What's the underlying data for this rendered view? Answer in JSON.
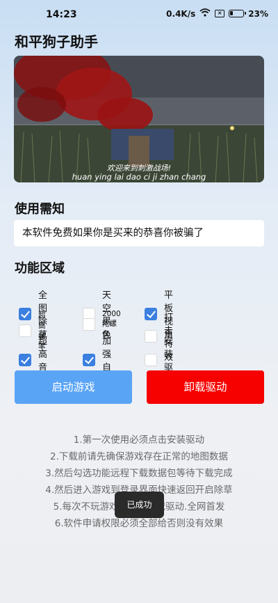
{
  "status_bar": {
    "time": "14:23",
    "network_speed": "0.4K/s",
    "battery": "23%"
  },
  "app": {
    "title": "和平狗子助手"
  },
  "banner": {
    "caption_cn": "欢迎来到刺激战场!",
    "caption_pinyin": "huan ying lai dao ci ji zhan chang"
  },
  "notice": {
    "title": "使用需知",
    "text": "本软件免费如果你是买来的恭喜你被骗了"
  },
  "features": {
    "title": "功能区域",
    "items": [
      {
        "label": "全图除草",
        "checked": true
      },
      {
        "label": "天空黑色",
        "checked": false
      },
      {
        "label": "平板视角",
        "checked": true
      },
      {
        "label": "超高帧率",
        "checked": false
      },
      {
        "label": "2000陀螺仪",
        "checked": false
      },
      {
        "label": "打击特效",
        "checked": false
      },
      {
        "label": "超高音质",
        "checked": true
      },
      {
        "label": "加强自瞄",
        "checked": true
      },
      {
        "label": "安装驱动",
        "checked": false
      }
    ]
  },
  "buttons": {
    "start": "启动游戏",
    "uninstall": "卸载驱动"
  },
  "instructions": [
    "1.第一次使用必须点击安装驱动",
    "2.下载前请先确保游戏存在正常的地图数据",
    "3.然后勾选功能远程下载数据包等待下载完成",
    "4.然后进入游戏到登录界面快速返回开启除草",
    "5.每次不玩游戏后都要卸载驱动.全网首发",
    "6.软件申请权限必须全部给否则没有效果"
  ],
  "toast": {
    "text": "已成功"
  },
  "colors": {
    "accent": "#3b7fe0",
    "start_button": "#5aa4f6",
    "uninstall_button": "#f70000"
  }
}
